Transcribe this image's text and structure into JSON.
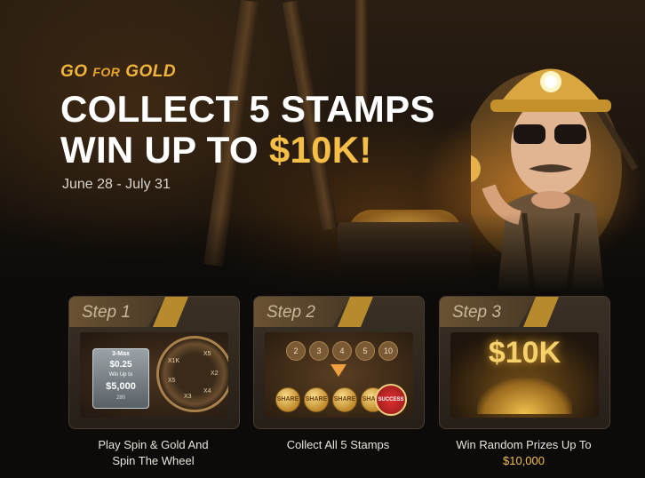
{
  "hero": {
    "brand_go": "GO",
    "brand_for": "FOR",
    "brand_gold": "GOLD",
    "headline_line1": "COLLECT 5 STAMPS",
    "headline_line2_prefix": "WIN UP TO ",
    "headline_line2_amount": "$10K!",
    "dates": "June 28 - July 31"
  },
  "steps": [
    {
      "label": "Step 1",
      "caption_line1": "Play Spin & Gold And",
      "caption_line2": "Spin The Wheel",
      "art": {
        "token_top": "3-Max",
        "token_buyin": "$0.25",
        "token_win_label": "Win Up to",
        "token_win_amount": "$5,000",
        "token_count": "280",
        "wheel_labels": [
          "X1K",
          "X5",
          "X2",
          "X4",
          "X3",
          "X5"
        ]
      }
    },
    {
      "label": "Step 2",
      "caption_line1": "Collect All 5 Stamps",
      "art": {
        "numbers": [
          "2",
          "3",
          "4",
          "5",
          "10"
        ],
        "coin_text": "SHARE",
        "badge": "SUCCESS"
      }
    },
    {
      "label": "Step 3",
      "caption_line1": "Win Random Prizes Up To",
      "caption_amount": "$10,000",
      "art": {
        "prize": "$10K"
      }
    }
  ],
  "colors": {
    "gold_accent": "#f4be47",
    "brand": "#f1b53a",
    "card_bg": "#2e261e"
  }
}
